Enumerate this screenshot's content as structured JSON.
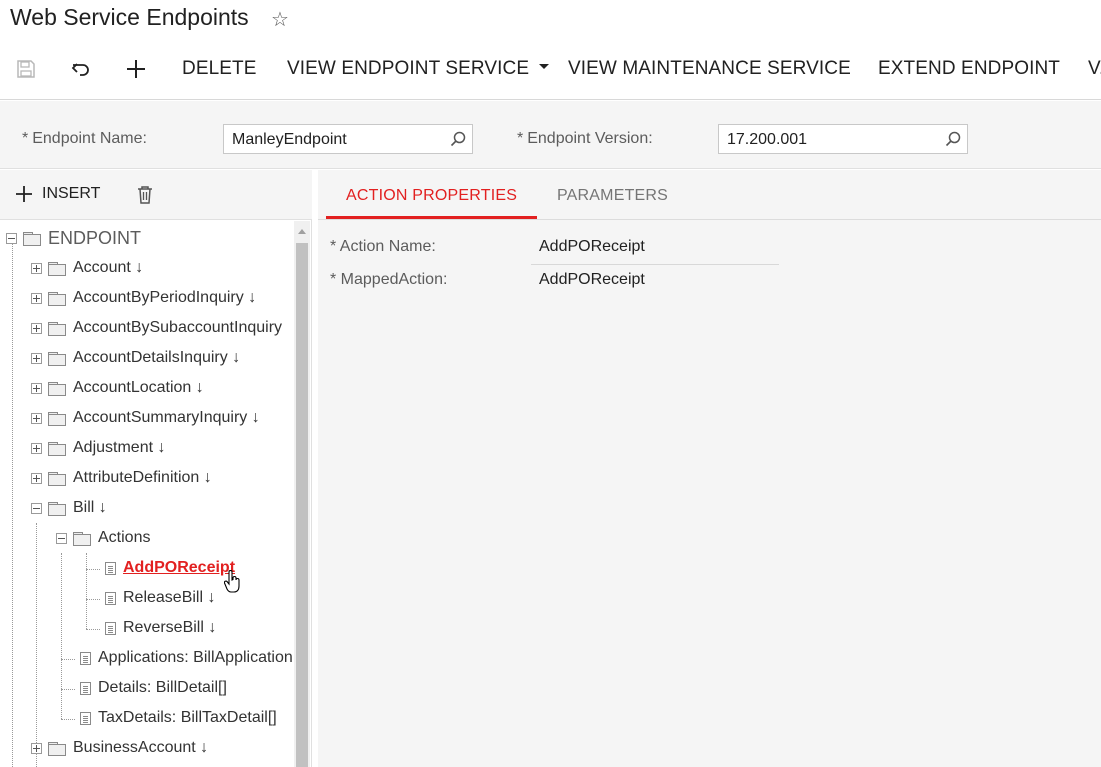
{
  "page": {
    "title": "Web Service Endpoints"
  },
  "toolbar": {
    "delete": "DELETE",
    "view_endpoint_service": "VIEW ENDPOINT SERVICE",
    "view_maintenance_service": "VIEW MAINTENANCE SERVICE",
    "extend_endpoint": "EXTEND ENDPOINT",
    "overflow": "V..."
  },
  "form": {
    "endpoint_name_label": "Endpoint Name:",
    "endpoint_name_value": "ManleyEndpoint",
    "endpoint_version_label": "Endpoint Version:",
    "endpoint_version_value": "17.200.001"
  },
  "tree_toolbar": {
    "insert": "INSERT"
  },
  "tree": {
    "root": "ENDPOINT",
    "items": [
      "Account ↓",
      "AccountByPeriodInquiry ↓",
      "AccountBySubaccountInquiry",
      "AccountDetailsInquiry ↓",
      "AccountLocation ↓",
      "AccountSummaryInquiry ↓",
      "Adjustment ↓",
      "AttributeDefinition ↓",
      "Bill ↓",
      "Actions",
      "AddPOReceipt",
      "ReleaseBill ↓",
      "ReverseBill ↓",
      "Applications: BillApplication",
      "Details: BillDetail[]",
      "TaxDetails: BillTaxDetail[]",
      "BusinessAccount ↓"
    ]
  },
  "tabs": {
    "action_properties": "ACTION PROPERTIES",
    "parameters": "PARAMETERS"
  },
  "properties": {
    "action_name_label": "Action Name:",
    "action_name_value": "AddPOReceipt",
    "mapped_action_label": "MappedAction:",
    "mapped_action_value": "AddPOReceipt"
  },
  "colors": {
    "accent": "#e22020"
  }
}
